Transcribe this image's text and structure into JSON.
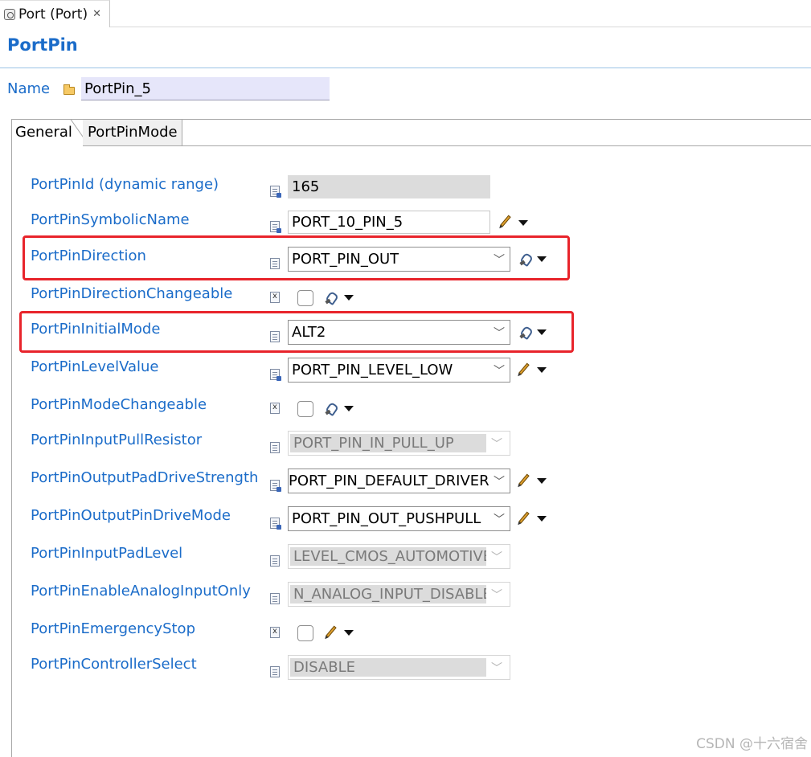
{
  "editor_tab": {
    "title": "Port (Port)",
    "close": "✕"
  },
  "page_title": "PortPin",
  "name": {
    "label": "Name",
    "value": "PortPin_5"
  },
  "tabs": [
    {
      "label": "General",
      "active": true
    },
    {
      "label": "PortPinMode",
      "active": false
    }
  ],
  "rows": {
    "pin_id": {
      "label": "PortPinId (dynamic range)",
      "value": "165"
    },
    "symbolic_name": {
      "label": "PortPinSymbolicName",
      "value": "PORT_10_PIN_5"
    },
    "direction": {
      "label": "PortPinDirection",
      "value": "PORT_PIN_OUT"
    },
    "direction_changeable": {
      "label": "PortPinDirectionChangeable",
      "checked": false
    },
    "initial_mode": {
      "label": "PortPinInitialMode",
      "value": "ALT2"
    },
    "level_value": {
      "label": "PortPinLevelValue",
      "value": "PORT_PIN_LEVEL_LOW"
    },
    "mode_changeable": {
      "label": "PortPinModeChangeable",
      "checked": false
    },
    "input_pull": {
      "label": "PortPinInputPullResistor",
      "value": "PORT_PIN_IN_PULL_UP"
    },
    "output_drive_strength": {
      "label": "PortPinOutputPadDriveStrength",
      "value": "PORT_PIN_DEFAULT_DRIVER"
    },
    "output_drive_mode": {
      "label": "PortPinOutputPinDriveMode",
      "value": "PORT_PIN_OUT_PUSHPULL"
    },
    "input_pad_level": {
      "label": "PortPinInputPadLevel",
      "value": "LEVEL_CMOS_AUTOMOTIVE"
    },
    "analog_input_only": {
      "label": "PortPinEnableAnalogInputOnly",
      "value": "N_ANALOG_INPUT_DISABLE"
    },
    "emergency_stop": {
      "label": "PortPinEmergencyStop",
      "checked": false
    },
    "controller_select": {
      "label": "PortPinControllerSelect",
      "value": "DISABLE"
    }
  },
  "combo_arrow": "﹀",
  "watermark": "CSDN @十六宿舍",
  "colors": {
    "label_blue": "#1b6cc9",
    "highlight_red": "#e8242b",
    "name_field_bg": "#e6e6fa"
  }
}
